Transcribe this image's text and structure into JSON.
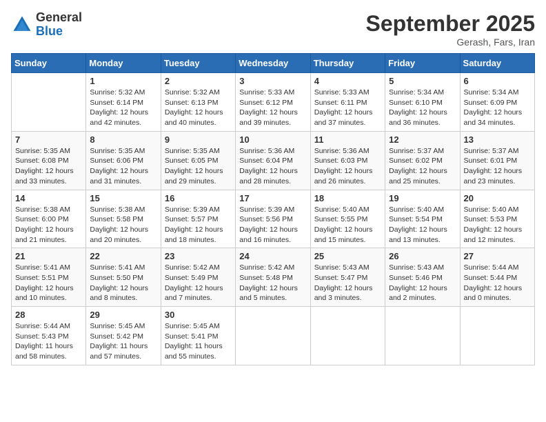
{
  "header": {
    "logo_general": "General",
    "logo_blue": "Blue",
    "month_title": "September 2025",
    "subtitle": "Gerash, Fars, Iran"
  },
  "weekdays": [
    "Sunday",
    "Monday",
    "Tuesday",
    "Wednesday",
    "Thursday",
    "Friday",
    "Saturday"
  ],
  "weeks": [
    [
      {
        "day": "",
        "info": ""
      },
      {
        "day": "1",
        "info": "Sunrise: 5:32 AM\nSunset: 6:14 PM\nDaylight: 12 hours\nand 42 minutes."
      },
      {
        "day": "2",
        "info": "Sunrise: 5:32 AM\nSunset: 6:13 PM\nDaylight: 12 hours\nand 40 minutes."
      },
      {
        "day": "3",
        "info": "Sunrise: 5:33 AM\nSunset: 6:12 PM\nDaylight: 12 hours\nand 39 minutes."
      },
      {
        "day": "4",
        "info": "Sunrise: 5:33 AM\nSunset: 6:11 PM\nDaylight: 12 hours\nand 37 minutes."
      },
      {
        "day": "5",
        "info": "Sunrise: 5:34 AM\nSunset: 6:10 PM\nDaylight: 12 hours\nand 36 minutes."
      },
      {
        "day": "6",
        "info": "Sunrise: 5:34 AM\nSunset: 6:09 PM\nDaylight: 12 hours\nand 34 minutes."
      }
    ],
    [
      {
        "day": "7",
        "info": "Sunrise: 5:35 AM\nSunset: 6:08 PM\nDaylight: 12 hours\nand 33 minutes."
      },
      {
        "day": "8",
        "info": "Sunrise: 5:35 AM\nSunset: 6:06 PM\nDaylight: 12 hours\nand 31 minutes."
      },
      {
        "day": "9",
        "info": "Sunrise: 5:35 AM\nSunset: 6:05 PM\nDaylight: 12 hours\nand 29 minutes."
      },
      {
        "day": "10",
        "info": "Sunrise: 5:36 AM\nSunset: 6:04 PM\nDaylight: 12 hours\nand 28 minutes."
      },
      {
        "day": "11",
        "info": "Sunrise: 5:36 AM\nSunset: 6:03 PM\nDaylight: 12 hours\nand 26 minutes."
      },
      {
        "day": "12",
        "info": "Sunrise: 5:37 AM\nSunset: 6:02 PM\nDaylight: 12 hours\nand 25 minutes."
      },
      {
        "day": "13",
        "info": "Sunrise: 5:37 AM\nSunset: 6:01 PM\nDaylight: 12 hours\nand 23 minutes."
      }
    ],
    [
      {
        "day": "14",
        "info": "Sunrise: 5:38 AM\nSunset: 6:00 PM\nDaylight: 12 hours\nand 21 minutes."
      },
      {
        "day": "15",
        "info": "Sunrise: 5:38 AM\nSunset: 5:58 PM\nDaylight: 12 hours\nand 20 minutes."
      },
      {
        "day": "16",
        "info": "Sunrise: 5:39 AM\nSunset: 5:57 PM\nDaylight: 12 hours\nand 18 minutes."
      },
      {
        "day": "17",
        "info": "Sunrise: 5:39 AM\nSunset: 5:56 PM\nDaylight: 12 hours\nand 16 minutes."
      },
      {
        "day": "18",
        "info": "Sunrise: 5:40 AM\nSunset: 5:55 PM\nDaylight: 12 hours\nand 15 minutes."
      },
      {
        "day": "19",
        "info": "Sunrise: 5:40 AM\nSunset: 5:54 PM\nDaylight: 12 hours\nand 13 minutes."
      },
      {
        "day": "20",
        "info": "Sunrise: 5:40 AM\nSunset: 5:53 PM\nDaylight: 12 hours\nand 12 minutes."
      }
    ],
    [
      {
        "day": "21",
        "info": "Sunrise: 5:41 AM\nSunset: 5:51 PM\nDaylight: 12 hours\nand 10 minutes."
      },
      {
        "day": "22",
        "info": "Sunrise: 5:41 AM\nSunset: 5:50 PM\nDaylight: 12 hours\nand 8 minutes."
      },
      {
        "day": "23",
        "info": "Sunrise: 5:42 AM\nSunset: 5:49 PM\nDaylight: 12 hours\nand 7 minutes."
      },
      {
        "day": "24",
        "info": "Sunrise: 5:42 AM\nSunset: 5:48 PM\nDaylight: 12 hours\nand 5 minutes."
      },
      {
        "day": "25",
        "info": "Sunrise: 5:43 AM\nSunset: 5:47 PM\nDaylight: 12 hours\nand 3 minutes."
      },
      {
        "day": "26",
        "info": "Sunrise: 5:43 AM\nSunset: 5:46 PM\nDaylight: 12 hours\nand 2 minutes."
      },
      {
        "day": "27",
        "info": "Sunrise: 5:44 AM\nSunset: 5:44 PM\nDaylight: 12 hours\nand 0 minutes."
      }
    ],
    [
      {
        "day": "28",
        "info": "Sunrise: 5:44 AM\nSunset: 5:43 PM\nDaylight: 11 hours\nand 58 minutes."
      },
      {
        "day": "29",
        "info": "Sunrise: 5:45 AM\nSunset: 5:42 PM\nDaylight: 11 hours\nand 57 minutes."
      },
      {
        "day": "30",
        "info": "Sunrise: 5:45 AM\nSunset: 5:41 PM\nDaylight: 11 hours\nand 55 minutes."
      },
      {
        "day": "",
        "info": ""
      },
      {
        "day": "",
        "info": ""
      },
      {
        "day": "",
        "info": ""
      },
      {
        "day": "",
        "info": ""
      }
    ]
  ]
}
